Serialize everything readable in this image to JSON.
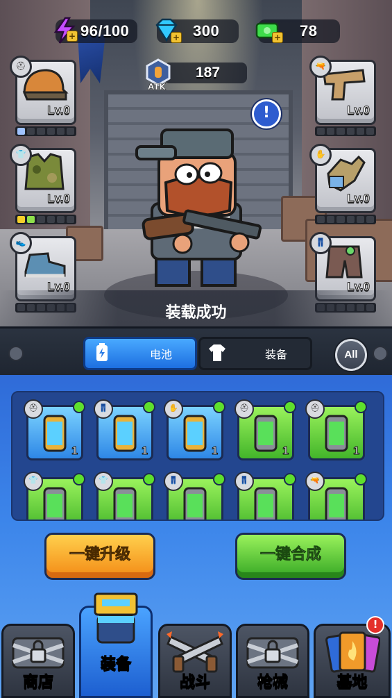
{
  "resources": {
    "energy": {
      "value": "96/100",
      "icon": "lightning-icon",
      "color": "#c54cff"
    },
    "gems": {
      "value": "300",
      "icon": "diamond-icon",
      "color": "#31c8ff"
    },
    "cash": {
      "value": "78",
      "icon": "cash-icon",
      "color": "#3ddc4a"
    }
  },
  "atk": {
    "label": "ATK",
    "value": "187"
  },
  "equipment_slots": {
    "left": [
      {
        "type": "helmet",
        "level": "Lv.0",
        "bar": [
          "b",
          "o",
          "o",
          "o",
          "o",
          "o"
        ]
      },
      {
        "type": "armor",
        "level": "Lv.0",
        "bar": [
          "y",
          "g",
          "o",
          "o",
          "o",
          "o"
        ]
      },
      {
        "type": "boots",
        "level": "Lv.0",
        "bar": [
          "o",
          "o",
          "o",
          "o",
          "o",
          "o"
        ]
      }
    ],
    "right": [
      {
        "type": "gun",
        "level": "Lv.0",
        "bar": [
          "o",
          "o",
          "o",
          "o",
          "o",
          "o"
        ]
      },
      {
        "type": "gloves",
        "level": "Lv.0",
        "bar": [
          "o",
          "o",
          "o",
          "o",
          "o",
          "o"
        ]
      },
      {
        "type": "pants",
        "level": "Lv.0",
        "bar": [
          "o",
          "o",
          "o",
          "o",
          "o",
          "o"
        ]
      }
    ]
  },
  "toast": "装载成功",
  "tabs": {
    "battery": "电池",
    "equipment": "装备",
    "all": "All"
  },
  "inventory": [
    {
      "slot": "helmet",
      "color": "blue",
      "count": "1"
    },
    {
      "slot": "pants",
      "color": "blue",
      "count": "1"
    },
    {
      "slot": "gloves",
      "color": "blue",
      "count": "1"
    },
    {
      "slot": "helmet",
      "color": "green",
      "count": "1"
    },
    {
      "slot": "helmet",
      "color": "green",
      "count": "1"
    },
    {
      "slot": "armor",
      "color": "green",
      "count": ""
    },
    {
      "slot": "armor",
      "color": "green",
      "count": ""
    },
    {
      "slot": "pants",
      "color": "green",
      "count": ""
    },
    {
      "slot": "pants",
      "color": "green",
      "count": ""
    },
    {
      "slot": "gun",
      "color": "green",
      "count": ""
    }
  ],
  "actions": {
    "upgrade_all": "一键升级",
    "merge_all": "一键合成"
  },
  "nav": [
    {
      "label": "商店",
      "icon": "locked-chain-icon",
      "active": false
    },
    {
      "label": "装备",
      "icon": "battery-armor-icon",
      "active": true
    },
    {
      "label": "战斗",
      "icon": "crossed-guns-icon",
      "active": false
    },
    {
      "label": "枪械",
      "icon": "locked-chain-icon",
      "active": false
    },
    {
      "label": "基地",
      "icon": "cards-icon",
      "active": false,
      "badge": "!"
    }
  ]
}
